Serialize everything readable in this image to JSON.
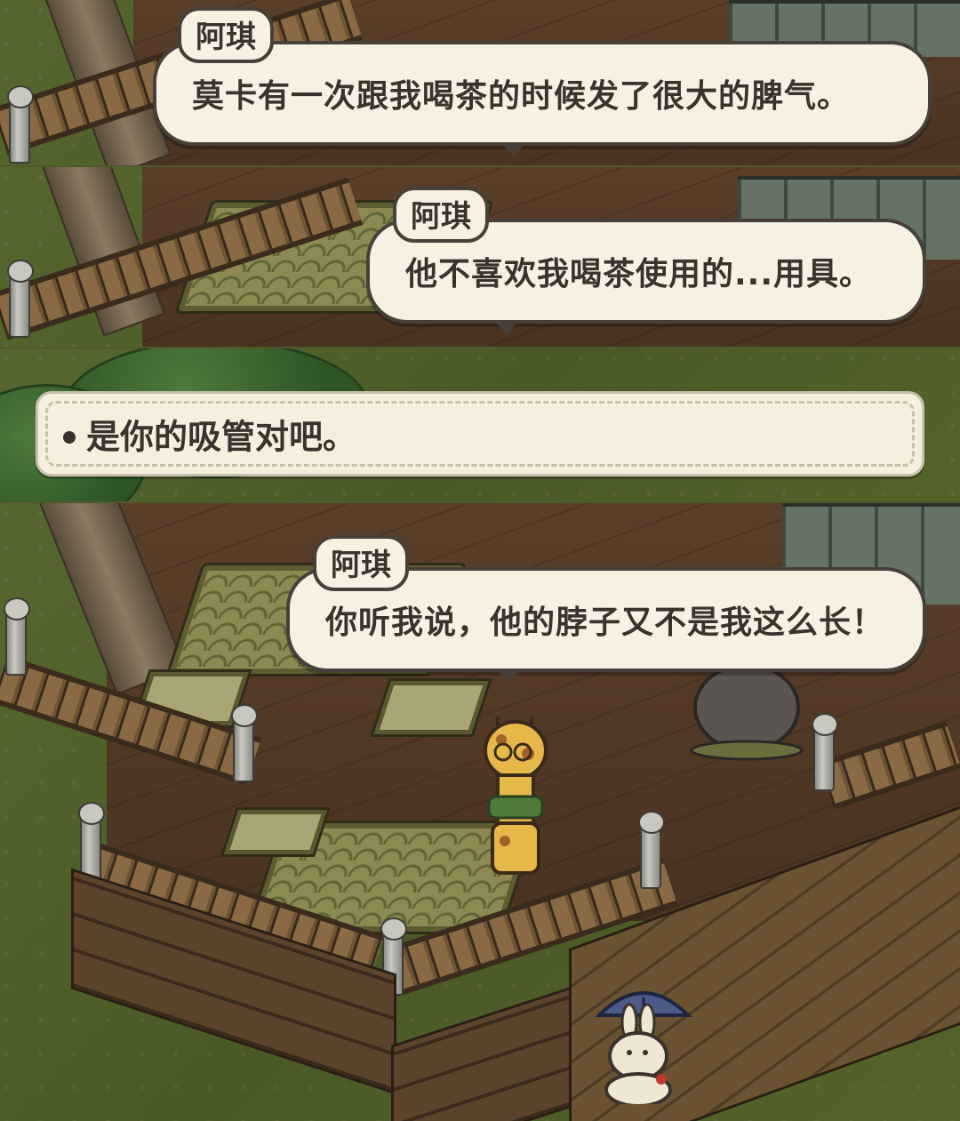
{
  "dialogues": [
    {
      "speaker": "阿琪",
      "text": "莫卡有一次跟我喝茶的时候发了很大的脾气。"
    },
    {
      "speaker": "阿琪",
      "text": "他不喜欢我喝茶使用的...用具。"
    },
    {
      "speaker": "阿琪",
      "text": "你听我说，他的脖子又不是我这么长！"
    }
  ],
  "choice": {
    "text": "是你的吸管对吧。"
  },
  "characters": {
    "speaker": "giraffe",
    "visitor": "rabbit-with-umbrella"
  }
}
